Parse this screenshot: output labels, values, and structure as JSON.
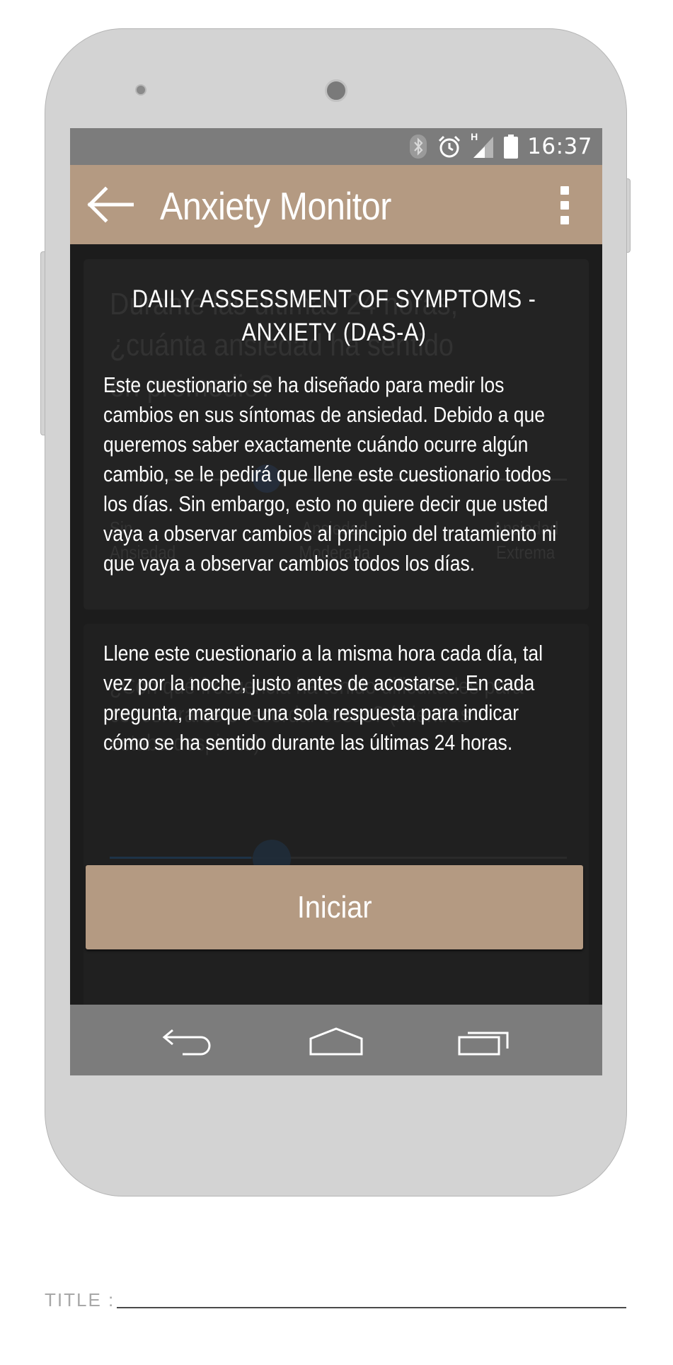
{
  "app": {
    "title": "Anxiety Monitor"
  },
  "statusbar": {
    "time": "16:37",
    "network_label": "H",
    "icons": [
      "bluetooth-icon",
      "alarm-icon",
      "signal-icon",
      "battery-icon"
    ]
  },
  "background": {
    "question1": "Durante las últimas 24 horas, ¿cuánta ansiedad ha sentido en promedio?",
    "scale_labels": [
      "Sin Ansiedad",
      "Ansiedad Moderada",
      "Ansiedad Extrema"
    ],
    "question2": "¿Con qué frecuencia ha tenido dificultades para concentrarse o recordar cosas? (mientras estaba despierto)"
  },
  "dialog": {
    "title": "DAILY ASSESSMENT OF SYMPTOMS - ANXIETY (DAS-A)",
    "paragraph1": "Este cuestionario se ha diseñado para medir los cambios en sus síntomas de ansiedad. Debido a que queremos saber exactamente cuándo ocurre algún cambio, se le pedirá que llene este cuestionario todos los días. Sin embargo, esto no quiere decir que usted vaya a observar cambios al principio del tratamiento ni que vaya a observar cambios todos los días.",
    "paragraph2": "Llene este cuestionario a la misma hora cada día, tal vez por la noche, justo antes de acostarse. En cada pregunta, marque una sola respuesta para indicar cómo se ha sentido durante las últimas 24 horas.",
    "start_button": "Iniciar"
  },
  "footer": {
    "title_label": "TITLE :"
  },
  "colors": {
    "accent": "#b49a82",
    "statusbar": "#7c7c7c",
    "screen_bg": "#1c1c1c",
    "phone_body": "#d3d3d3"
  }
}
